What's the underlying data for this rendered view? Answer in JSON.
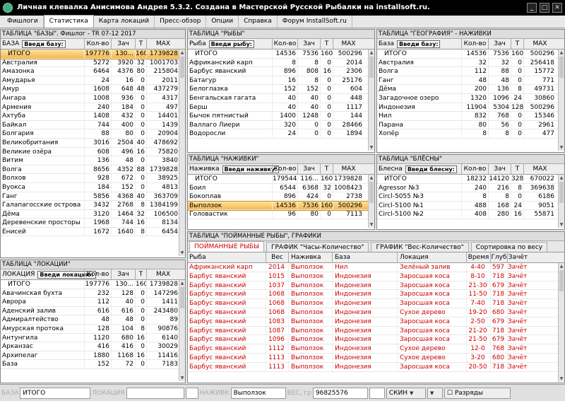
{
  "window": {
    "title": "Личная клевалка Анисимова Андрея 5.3.2. Создана в Мастерской Русской Рыбалки на installsoft.ru."
  },
  "menu_tabs": [
    "Фишлоги",
    "Статистика",
    "Карта локаций",
    "Пресс-обзор",
    "Опции",
    "Справка",
    "Форум InstallSoft.ru"
  ],
  "active_tab": 1,
  "bases": {
    "title": "ТАБЛИЦА \"БАЗЫ\". Фишлог  - TR 07-12 2017",
    "col0": "БАЗА",
    "input": "Введи базу:",
    "cols": [
      "Кол-во",
      "Зач",
      "Т",
      "MAX"
    ],
    "rows": [
      [
        "ИТОГО",
        "197776",
        "130...",
        "160",
        "1739828"
      ],
      [
        "Австралия",
        "5272",
        "3920",
        "32",
        "1001703"
      ],
      [
        "Амазонка",
        "6464",
        "4376",
        "80",
        "215804"
      ],
      [
        "Амударья",
        "24",
        "16",
        "0",
        "2011"
      ],
      [
        "Амур",
        "1608",
        "648",
        "48",
        "437279"
      ],
      [
        "Ангара",
        "1008",
        "936",
        "0",
        "4317"
      ],
      [
        "Армения",
        "240",
        "184",
        "0",
        "497"
      ],
      [
        "Ахтуба",
        "1408",
        "432",
        "0",
        "14401"
      ],
      [
        "Байкал",
        "744",
        "400",
        "0",
        "1439"
      ],
      [
        "Болгария",
        "88",
        "80",
        "0",
        "20904"
      ],
      [
        "Великобритания",
        "3016",
        "2504",
        "40",
        "478692"
      ],
      [
        "Великие озёра",
        "608",
        "496",
        "16",
        "75820"
      ],
      [
        "Витим",
        "136",
        "48",
        "0",
        "3840"
      ],
      [
        "Волга",
        "8656",
        "4352",
        "88",
        "1739828"
      ],
      [
        "Волхов",
        "928",
        "672",
        "0",
        "38925"
      ],
      [
        "Вуокса",
        "184",
        "152",
        "0",
        "4813"
      ],
      [
        "Ганг",
        "5856",
        "4368",
        "40",
        "363709"
      ],
      [
        "Галапагосские острова",
        "3432",
        "2768",
        "8",
        "1384199"
      ],
      [
        "Дёма",
        "3120",
        "1464",
        "32",
        "106500"
      ],
      [
        "Деревенские просторы",
        "1968",
        "744",
        "16",
        "8134"
      ],
      [
        "Енисей",
        "1672",
        "1640",
        "8",
        "6454"
      ]
    ]
  },
  "locations": {
    "title": "ТАБЛИЦА \"ЛОКАЦИИ\"",
    "col0": "ЛОКАЦИЯ",
    "input": "Введи локацию:",
    "cols": [
      "Кол-во",
      "Зач",
      "T",
      "MAX"
    ],
    "rows": [
      [
        "ИТОГО",
        "197776",
        "130...",
        "160",
        "1739828"
      ],
      [
        "Авачинская бухта",
        "232",
        "128",
        "0",
        "147296"
      ],
      [
        "Аврора",
        "112",
        "40",
        "0",
        "1411"
      ],
      [
        "Аденский залив",
        "616",
        "616",
        "0",
        "243480"
      ],
      [
        "Адмиралтейство",
        "48",
        "48",
        "0",
        "89"
      ],
      [
        "Амурская протока",
        "128",
        "104",
        "8",
        "90876"
      ],
      [
        "Антунгила",
        "1120",
        "680",
        "16",
        "6140"
      ],
      [
        "Арканзас",
        "416",
        "416",
        "0",
        "30029"
      ],
      [
        "Архипелаг",
        "1880",
        "1168",
        "16",
        "11416"
      ],
      [
        "База",
        "152",
        "72",
        "0",
        "7183"
      ]
    ]
  },
  "fish": {
    "title": "ТАБЛИЦА \"РЫБЫ\"",
    "col0": "Рыба",
    "input": "Введи рыбу:",
    "cols": [
      "Кол-во",
      "Зач",
      "T",
      "MAX"
    ],
    "rows": [
      [
        "ИТОГО",
        "14536",
        "7536",
        "160",
        "500296"
      ],
      [
        "Африканский карп",
        "8",
        "8",
        "0",
        "2014"
      ],
      [
        "Барбус яванский",
        "896",
        "808",
        "16",
        "2306"
      ],
      [
        "Батагур",
        "16",
        "8",
        "0",
        "25176"
      ],
      [
        "Белоглазка",
        "152",
        "152",
        "0",
        "604"
      ],
      [
        "Бенгальская гагата",
        "40",
        "40",
        "0",
        "448"
      ],
      [
        "Берш",
        "40",
        "40",
        "0",
        "1117"
      ],
      [
        "Бычок пятнистый",
        "1400",
        "1248",
        "0",
        "144"
      ],
      [
        "Валлаго Лиери",
        "320",
        "0",
        "0",
        "28466"
      ],
      [
        "Водоросли",
        "24",
        "0",
        "0",
        "1894"
      ]
    ]
  },
  "geo": {
    "title": "ТАБЛИЦА \"ГЕОГРАФИЯ\" - НАЖИВКИ",
    "col0": "База",
    "input": "Введи базу:",
    "cols": [
      "Кол-во",
      "Зач",
      "T",
      "MAX"
    ],
    "rows": [
      [
        "ИТОГО",
        "14536",
        "7536",
        "160",
        "500296"
      ],
      [
        "Австралия",
        "32",
        "32",
        "0",
        "256418"
      ],
      [
        "Волга",
        "112",
        "88",
        "0",
        "15772"
      ],
      [
        "Ганг",
        "48",
        "48",
        "0",
        "771"
      ],
      [
        "Дёма",
        "200",
        "136",
        "8",
        "49731"
      ],
      [
        "Загадочное озеро",
        "1320",
        "1096",
        "24",
        "30860"
      ],
      [
        "Индонезия",
        "11904",
        "5304",
        "128",
        "500296"
      ],
      [
        "Нил",
        "832",
        "768",
        "0",
        "15346"
      ],
      [
        "Парана",
        "80",
        "56",
        "0",
        "2961"
      ],
      [
        "Хопёр",
        "8",
        "8",
        "0",
        "477"
      ]
    ]
  },
  "baits": {
    "title": "ТАБЛИЦА \"НАЖИВКИ\"",
    "col0": "Наживка",
    "input": "Введи наживку:",
    "cols": [
      "Кол-во",
      "Зач",
      "T",
      "MAX"
    ],
    "rows": [
      [
        "ИТОГО",
        "179544",
        "116...",
        "160",
        "1739828"
      ],
      [
        "Боил",
        "6544",
        "6368",
        "32",
        "1008423"
      ],
      [
        "Бокоплав",
        "896",
        "424",
        "0",
        "2738"
      ],
      [
        "Выползок",
        "14536",
        "7536",
        "160",
        "500296"
      ],
      [
        "Головастик",
        "96",
        "80",
        "0",
        "7113"
      ]
    ],
    "selected": 3
  },
  "lures": {
    "title": "ТАБЛИЦА \"БЛЁСНЫ\"",
    "col0": "Блесна",
    "input": "Введи блесну:",
    "cols": [
      "Кол-во",
      "Зач",
      "T",
      "MAX"
    ],
    "rows": [
      [
        "ИТОГО",
        "18232",
        "14120",
        "328",
        "670022"
      ],
      [
        "Agressor №3",
        "240",
        "216",
        "8",
        "369638"
      ],
      [
        "Circl-5055 №3",
        "8",
        "8",
        "0",
        "6186"
      ],
      [
        "Circl-5100 №1",
        "488",
        "168",
        "24",
        "9051"
      ],
      [
        "Circl-5100 №2",
        "408",
        "280",
        "16",
        "55871"
      ]
    ]
  },
  "catch": {
    "title": "ТАБЛИЦА \"ПОЙМАННЫЕ РЫБЫ\", ГРАФИКИ",
    "tabs": [
      "ПОЙМАННЫЕ РЫБЫ",
      "ГРАФИК \"Часы-Количество\"",
      "ГРАФИК \"Вес-Количество\"",
      "Сортировка по весу"
    ],
    "cols": [
      "Рыба",
      "Вес",
      "Наживка",
      "База",
      "Локация",
      "Время",
      "Глуб",
      "Зачёт"
    ],
    "rows": [
      [
        "Африканский карп",
        "2014",
        "Выползок",
        "Нил",
        "Зелёный залив",
        "4-40",
        "597",
        "Зачёт"
      ],
      [
        "Барбус яванский",
        "1015",
        "Выползок",
        "Индонезия",
        "Заросшая коса",
        "8-10",
        "718",
        "Зачёт"
      ],
      [
        "Барбус яванский",
        "1037",
        "Выползок",
        "Индонезия",
        "Заросшая коса",
        "21-30",
        "679",
        "Зачёт"
      ],
      [
        "Барбус яванский",
        "1068",
        "Выползок",
        "Индонезия",
        "Заросшая коса",
        "11-50",
        "718",
        "Зачёт"
      ],
      [
        "Барбус яванский",
        "1068",
        "Выползок",
        "Индонезия",
        "Заросшая коса",
        "7-40",
        "718",
        "Зачёт"
      ],
      [
        "Барбус яванский",
        "1068",
        "Выползок",
        "Индонезия",
        "Сухое дерево",
        "19-20",
        "680",
        "Зачёт"
      ],
      [
        "Барбус яванский",
        "1083",
        "Выползок",
        "Индонезия",
        "Заросшая коса",
        "2-50",
        "679",
        "Зачёт"
      ],
      [
        "Барбус яванский",
        "1087",
        "Выползок",
        "Индонезия",
        "Заросшая коса",
        "21-20",
        "718",
        "Зачёт"
      ],
      [
        "Барбус яванский",
        "1096",
        "Выползок",
        "Индонезия",
        "Заросшая коса",
        "21-50",
        "679",
        "Зачёт"
      ],
      [
        "Барбус яванский",
        "1112",
        "Выползок",
        "Индонезия",
        "Сухое дерево",
        "12-0",
        "768",
        "Зачёт"
      ],
      [
        "Барбус яванский",
        "1113",
        "Выползок",
        "Индонезия",
        "Сухое дерево",
        "3-20",
        "680",
        "Зачёт"
      ],
      [
        "Барбус яванский",
        "1113",
        "Выползок",
        "Индонезия",
        "Заросшая коса",
        "20-50",
        "718",
        "Зачёт"
      ]
    ]
  },
  "status": {
    "base_label": "БАЗА",
    "base_value": "ИТОГО",
    "loc_label": "ЛОКАЦИЯ",
    "bait_label": "НАЖИВК",
    "bait_value": "Выползок",
    "weight_label": "ВЕС, гр",
    "weight_value": "96825576",
    "skin_label": "СКИН",
    "ranks_label": "Разряды"
  }
}
